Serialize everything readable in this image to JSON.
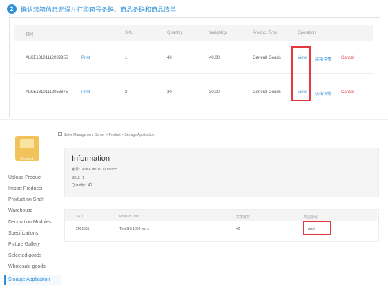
{
  "step": {
    "number": "2",
    "title": "确认装箱信息无误并打印箱号条码、商品条码和商品清单"
  },
  "box_table": {
    "headers": [
      "箱号",
      "SKU",
      "Quantity",
      "Weight(g)",
      "Product Type",
      "Operation"
    ],
    "rows": [
      {
        "box_no": "ALKE18101112032955",
        "print": "Print",
        "sku": "1",
        "quantity": "40",
        "weight": "40.00",
        "type": "General Goods",
        "view": "View",
        "detail": "装箱详情",
        "cancel": "Cancel"
      },
      {
        "box_no": "ALKE18101112053875",
        "print": "Print",
        "sku": "2",
        "quantity": "30",
        "weight": "30.00",
        "type": "General Goods",
        "view": "View",
        "detail": "装箱详情",
        "cancel": "Cancel"
      }
    ]
  },
  "breadcrumb": "Seller Management Center > Product > Storage Application",
  "logo_label": "Product",
  "sidebar": {
    "items": [
      "Upload Product",
      "Import Products",
      "Product on Shelf",
      "Warehouse",
      "Decoration Modules",
      "Specifications",
      "Picture Gallery",
      "Selected goods",
      "Wholesale goods",
      "Storage Application"
    ],
    "active_index": 9
  },
  "info": {
    "title": "Information",
    "box_no": "箱号：ALKE18101112032955",
    "sku": "SKU：1",
    "quantity": "Quantity：40"
  },
  "detail_table": {
    "headers": [
      "SKU",
      "Product Title",
      "实发库存",
      "商品条码"
    ],
    "rows": [
      {
        "sku": "2681561",
        "title": "Test GS 1009 red s",
        "stock": "40",
        "barcode": "print"
      }
    ]
  },
  "colors": {
    "accent": "#2f8fd8",
    "danger": "#e4393c"
  }
}
